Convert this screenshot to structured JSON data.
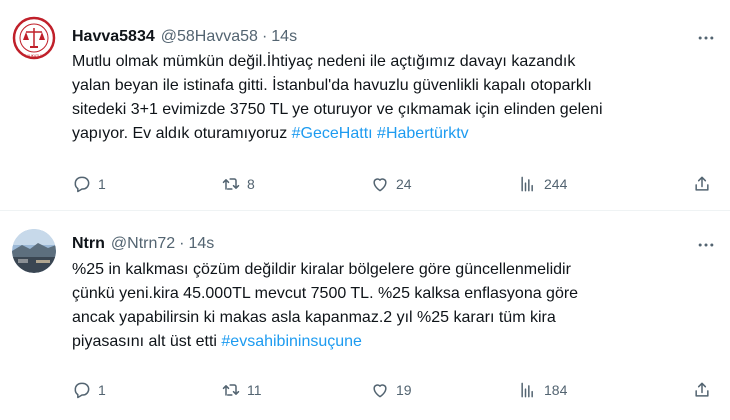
{
  "tweets": [
    {
      "name": "Havva5834",
      "handle": "@58Havva58",
      "separator": "·",
      "time": "14s",
      "text_lines": [
        [
          {
            "t": "Mutlu olmak mümkün değil.İhtiyaç nedeni ile açtığımız davayı kazandık"
          }
        ],
        [
          {
            "t": "yalan beyan ile istinafa gitti. İstanbul'da havuzlu güvenlikli kapalı otoparklı"
          }
        ],
        [
          {
            "t": "sitedeki 3+1 evimizde 3750 TL ye oturuyor ve çıkmamak için elinden geleni"
          }
        ],
        [
          {
            "t": "yapıyor. Ev aldık oturamıyoruz "
          },
          {
            "t": "#GeceHattı",
            "h": true
          },
          {
            "t": " "
          },
          {
            "t": "#Habertürktv",
            "h": true
          }
        ]
      ],
      "replies": "1",
      "retweets": "8",
      "likes": "24",
      "views": "244",
      "avatar_text": "AVUKATLIK"
    },
    {
      "name": "Ntrn",
      "handle": "@Ntrn72",
      "separator": "·",
      "time": "14s",
      "text_lines": [
        [
          {
            "t": "%25 in kalkması çözüm değildir kiralar bölgelere göre güncellenmelidir"
          }
        ],
        [
          {
            "t": "çünkü yeni.kira 45.000TL mevcut 7500 TL.  %25 kalksa enflasyona göre"
          }
        ],
        [
          {
            "t": "ancak yapabilirsin ki makas asla kapanmaz.2 yıl %25 kararı tüm kira"
          }
        ],
        [
          {
            "t": "piyasasını alt üst etti "
          },
          {
            "t": "#evsahibininsuçune",
            "h": true
          }
        ]
      ],
      "replies": "1",
      "retweets": "11",
      "likes": "19",
      "views": "184"
    }
  ],
  "colors": {
    "text": "#0f1419",
    "secondary": "#536471",
    "hashtag": "#1d9bf0",
    "divider": "#eff3f4"
  },
  "icons": [
    "reply-icon",
    "retweet-icon",
    "like-icon",
    "views-icon",
    "share-icon",
    "more-icon"
  ]
}
